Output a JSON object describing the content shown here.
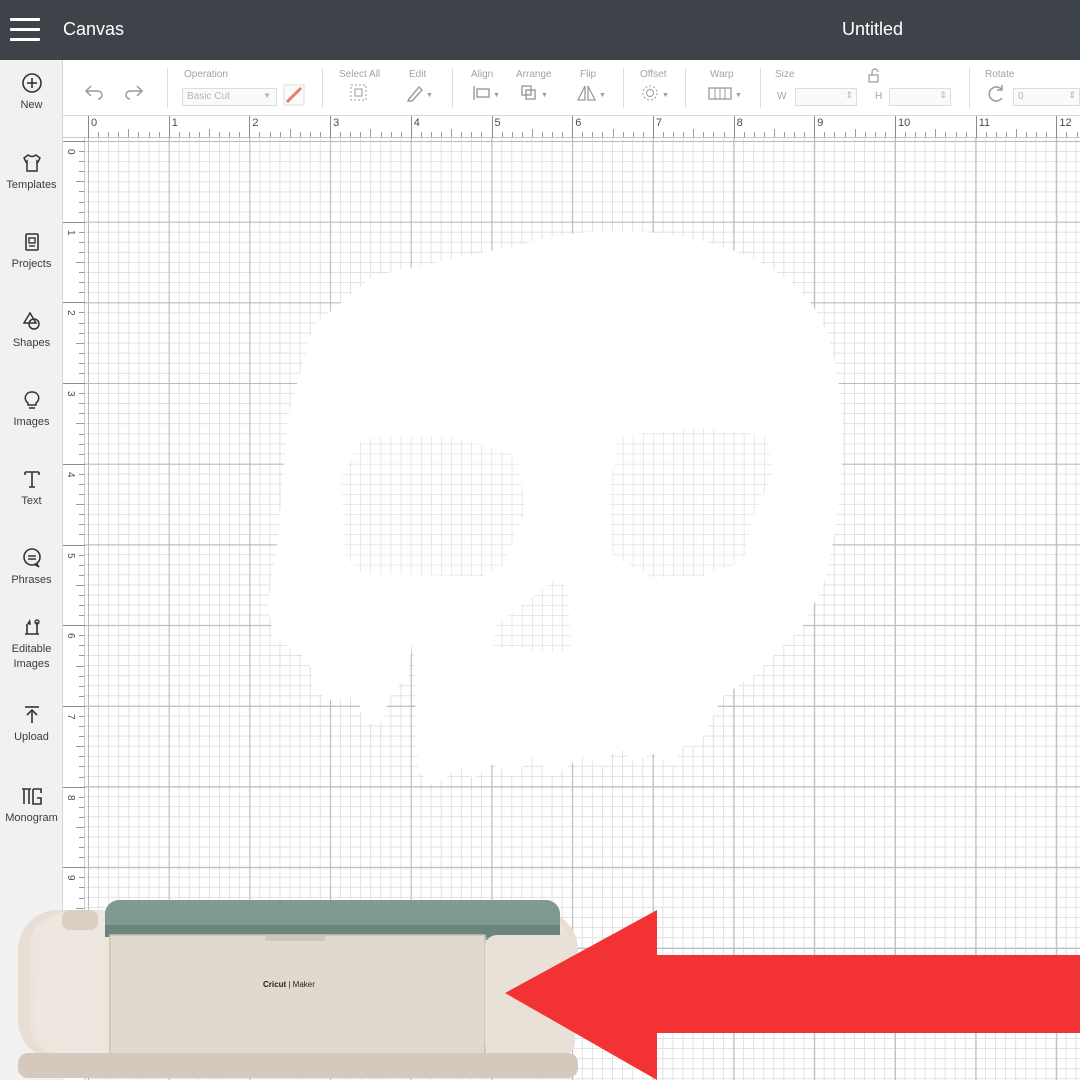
{
  "topbar": {
    "app_title": "Canvas",
    "document_title": "Untitled",
    "menu_icon": "hamburger-menu-icon"
  },
  "sidebar": {
    "items": [
      {
        "label": "New",
        "icon": "plus-circle-icon"
      },
      {
        "label": "Templates",
        "icon": "tshirt-icon"
      },
      {
        "label": "Projects",
        "icon": "projects-icon"
      },
      {
        "label": "Shapes",
        "icon": "shapes-icon"
      },
      {
        "label": "Images",
        "icon": "lightbulb-icon"
      },
      {
        "label": "Text",
        "icon": "text-icon"
      },
      {
        "label": "Phrases",
        "icon": "speech-bubble-icon"
      },
      {
        "label": "Editable Images",
        "icon": "editable-images-icon"
      },
      {
        "label": "Upload",
        "icon": "upload-icon"
      },
      {
        "label": "Monogram",
        "icon": "monogram-icon"
      }
    ]
  },
  "toolbar": {
    "operation_label": "Operation",
    "operation_value": "Basic Cut",
    "select_all_label": "Select All",
    "edit_label": "Edit",
    "align_label": "Align",
    "arrange_label": "Arrange",
    "flip_label": "Flip",
    "offset_label": "Offset",
    "warp_label": "Warp",
    "size_label": "Size",
    "width_label": "W",
    "height_label": "H",
    "rotate_label": "Rotate",
    "rotate_value": "0"
  },
  "rulers": {
    "horizontal": [
      "0",
      "1",
      "2",
      "3",
      "4",
      "5",
      "6",
      "7",
      "8",
      "9",
      "10",
      "11",
      "12"
    ],
    "vertical": [
      "0",
      "1",
      "2",
      "3",
      "4",
      "5",
      "6",
      "7",
      "8",
      "9"
    ]
  },
  "overlay": {
    "machine_brand": "Cricut",
    "machine_model": "Maker",
    "arrow_color": "#f33333",
    "machine_lid_color": "#7f9a92"
  },
  "colors": {
    "topbar_bg": "#3e4349",
    "sidebar_bg": "#f1f1f1",
    "grid_major": "#b9b9b9",
    "grid_minor": "#e1e1e1",
    "skull_fill": "#ffffff"
  }
}
